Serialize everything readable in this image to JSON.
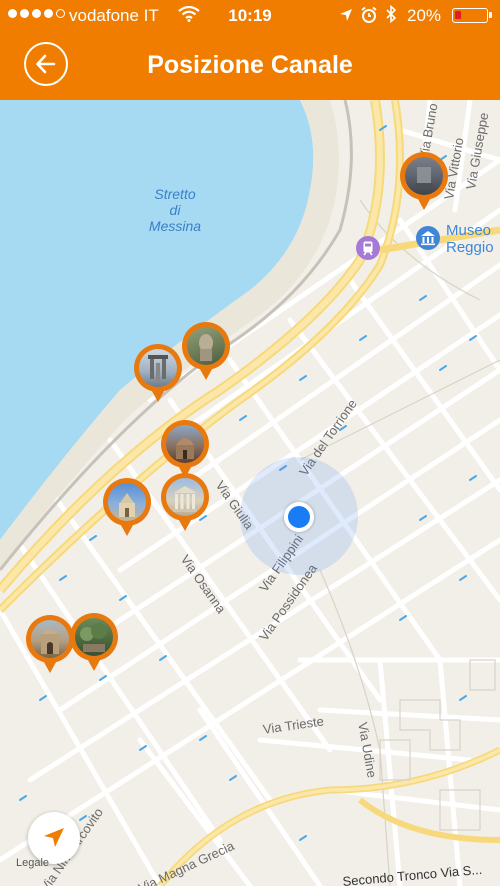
{
  "status_bar": {
    "carrier": "vodafone IT",
    "time": "10:19",
    "battery": "20%",
    "battery_level": 0.2,
    "icons": [
      "signal-dots-icon",
      "wifi-icon",
      "location-arrow-icon",
      "alarm-clock-icon",
      "bluetooth-icon",
      "battery-icon"
    ]
  },
  "nav": {
    "title": "Posizione Canale",
    "back_icon": "back-arrow-icon"
  },
  "map": {
    "water_label": "Stretto di Messina",
    "water_label_lines": [
      "Stretto",
      "di",
      "Messina"
    ],
    "poi_museum": "Museo Reggio",
    "poi_museum_lines": [
      "Museo",
      "Reggio"
    ],
    "streets": {
      "bruno": "Via Bruno",
      "vittorio": "Via Vittorio",
      "giuseppe": "Via Giuseppe",
      "torrione": "Via del Torrione",
      "giulia": "Via Giulia",
      "filippini": "Via Filippini",
      "osanna": "Via Osanna",
      "possidonea": "Via Possidonea",
      "trieste": "Via Trieste",
      "udine": "Via Udine",
      "arcovito": "Via Nino Arcovito",
      "magna_grecia": "Via Magna Grecia",
      "secondo_tronco": "Secondo Tronco Via S..."
    },
    "legal": "Legale",
    "locate_icon": "locate-arrow-icon",
    "transit_icon": "train-station-icon",
    "museum_icon": "museum-icon",
    "pins": [
      "pin-monument",
      "pin-statue",
      "pin-pillar-monument",
      "pin-church-dome",
      "pin-cathedral",
      "pin-classical-building",
      "pin-church-facade",
      "pin-garden"
    ],
    "colors": {
      "accent": "#f07c00",
      "water": "#a6d9f2",
      "land": "#f2efe9",
      "user_location": "#1a7cf5"
    }
  }
}
